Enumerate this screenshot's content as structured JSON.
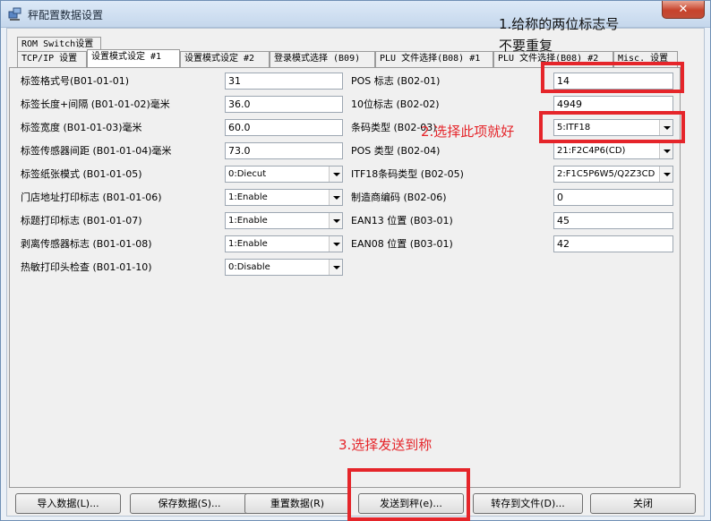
{
  "window": {
    "title": "秤配置数据设置",
    "close_label": "✕"
  },
  "tabs_row1": [
    {
      "label": "ROM Switch设置"
    }
  ],
  "tabs_row2": [
    {
      "label": "TCP/IP 设置"
    },
    {
      "label": "设置模式设定 #1"
    },
    {
      "label": "设置模式设定 #2"
    },
    {
      "label": "登录模式选择 (B09)"
    },
    {
      "label": "PLU 文件选择(B08) #1"
    },
    {
      "label": "PLU 文件选择(B08) #2"
    },
    {
      "label": "Misc. 设置"
    }
  ],
  "left_fields": [
    {
      "label": "标签格式号(B01-01-01)",
      "value": "31"
    },
    {
      "label": "标签长度+间隔 (B01-01-02)毫米",
      "value": "36.0"
    },
    {
      "label": "标签宽度 (B01-01-03)毫米",
      "value": "60.0"
    },
    {
      "label": "标签传感器间距 (B01-01-04)毫米",
      "value": "73.0"
    },
    {
      "label": "标签纸张模式 (B01-01-05)",
      "value": "0:Diecut"
    },
    {
      "label": "门店地址打印标志 (B01-01-06)",
      "value": "1:Enable"
    },
    {
      "label": "标题打印标志 (B01-01-07)",
      "value": "1:Enable"
    },
    {
      "label": "剥离传感器标志 (B01-01-08)",
      "value": "1:Enable"
    },
    {
      "label": "热敏打印头检查 (B01-01-10)",
      "value": "0:Disable"
    }
  ],
  "right_fields": [
    {
      "label": "POS 标志 (B02-01)",
      "value": "14"
    },
    {
      "label": "10位标志 (B02-02)",
      "value": "4949"
    },
    {
      "label": "条码类型 (B02-03)",
      "value": "5:ITF18"
    },
    {
      "label": "POS 类型 (B02-04)",
      "value": "21:F2C4P6(CD)"
    },
    {
      "label": "ITF18条码类型 (B02-05)",
      "value": "2:F1C5P6W5/Q2Z3CD"
    },
    {
      "label": "制造商编码 (B02-06)",
      "value": "0"
    },
    {
      "label": "EAN13 位置 (B03-01)",
      "value": "45"
    },
    {
      "label": "EAN08 位置 (B03-01)",
      "value": "42"
    }
  ],
  "buttons": {
    "import": "导入数据(L)...",
    "save": "保存数据(S)...",
    "reset": "重置数据(R)",
    "send": "发送到秤(e)...",
    "export": "转存到文件(D)...",
    "close": "关闭"
  },
  "annotations": {
    "note1_line1": "1.给称的两位标志号",
    "note1_line2": "不要重复",
    "note2": "2.选择此项就好",
    "note3": "3.选择发送到称",
    "note_color": "#e5252a"
  }
}
